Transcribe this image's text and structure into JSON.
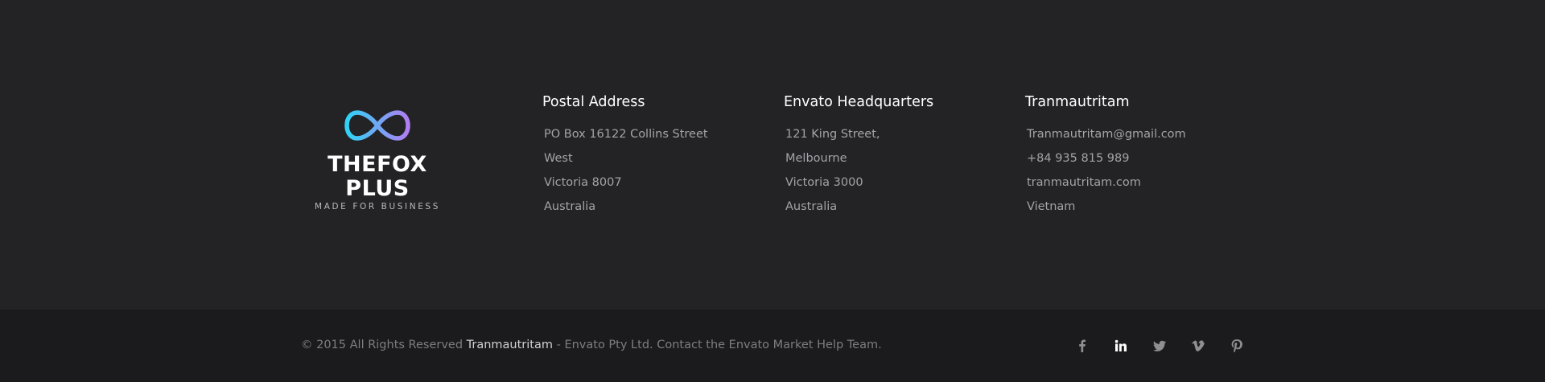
{
  "brand": {
    "name": "THEFOX PLUS",
    "tagline": "MADE FOR BUSINESS",
    "gradient_start": "#2fd3f7",
    "gradient_end": "#b07ef2"
  },
  "columns": [
    {
      "heading": "Postal Address",
      "lines": [
        "PO Box 16122 Collins Street",
        "West",
        "Victoria 8007",
        "Australia"
      ]
    },
    {
      "heading": "Envato Headquarters",
      "lines": [
        "121 King Street,",
        "Melbourne",
        "Victoria 3000",
        "Australia"
      ]
    },
    {
      "heading": "Tranmautritam",
      "lines": [
        "Tranmautritam@gmail.com",
        "+84 935 815 989",
        "tranmautritam.com",
        "Vietnam"
      ]
    }
  ],
  "copyright": {
    "prefix": "© 2015 All Rights Reserved ",
    "brand": "Tranmautritam",
    "suffix": " - Envato Pty Ltd. Contact the Envato Market Help Team."
  },
  "social": [
    {
      "icon": "facebook-icon",
      "active": false
    },
    {
      "icon": "linkedin-icon",
      "active": true
    },
    {
      "icon": "twitter-icon",
      "active": false
    },
    {
      "icon": "vimeo-icon",
      "active": false
    },
    {
      "icon": "pinterest-icon",
      "active": false
    }
  ],
  "colors": {
    "footer_top_bg": "#232326",
    "footer_bottom_bg": "#1b1b1d",
    "heading": "#ffffff",
    "body_text": "#a3a3a8",
    "muted_text": "#7d7d82"
  }
}
